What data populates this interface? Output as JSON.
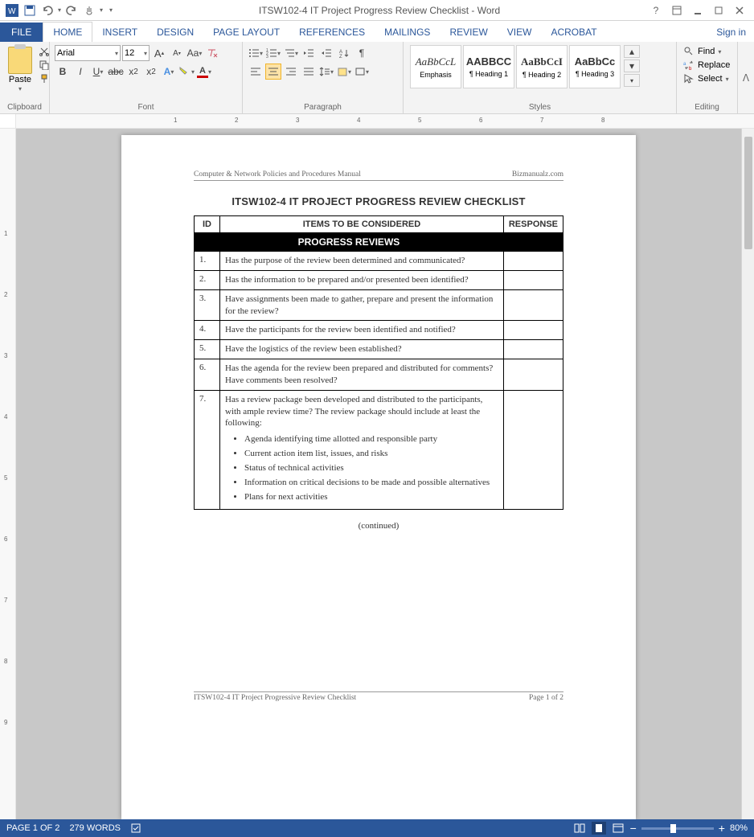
{
  "titlebar": {
    "title": "ITSW102-4 IT Project Progress Review Checklist - Word"
  },
  "tabs": {
    "file": "FILE",
    "items": [
      "HOME",
      "INSERT",
      "DESIGN",
      "PAGE LAYOUT",
      "REFERENCES",
      "MAILINGS",
      "REVIEW",
      "VIEW",
      "ACROBAT"
    ],
    "active": 0,
    "signin": "Sign in"
  },
  "ribbon": {
    "clipboard": {
      "label": "Clipboard",
      "paste": "Paste"
    },
    "font": {
      "label": "Font",
      "name": "Arial",
      "size": "12"
    },
    "paragraph": {
      "label": "Paragraph"
    },
    "styles": {
      "label": "Styles",
      "items": [
        {
          "preview": "AaBbCcL",
          "name": "Emphasis",
          "style": "italic",
          "font": "serif"
        },
        {
          "preview": "AABBCC",
          "name": "¶ Heading 1",
          "style": "bold",
          "font": "sans"
        },
        {
          "preview": "AaBbCcI",
          "name": "¶ Heading 2",
          "style": "bold",
          "font": "serif"
        },
        {
          "preview": "AaBbCc",
          "name": "¶ Heading 3",
          "style": "bold",
          "font": "sans"
        }
      ]
    },
    "editing": {
      "label": "Editing",
      "find": "Find",
      "replace": "Replace",
      "select": "Select"
    }
  },
  "document": {
    "header_left": "Computer & Network Policies and Procedures Manual",
    "header_right": "Bizmanualz.com",
    "title": "ITSW102-4   IT PROJECT PROGRESS REVIEW CHECKLIST",
    "columns": {
      "id": "ID",
      "items": "ITEMS TO BE CONSIDERED",
      "response": "RESPONSE"
    },
    "section": "PROGRESS REVIEWS",
    "rows": [
      {
        "id": "1.",
        "text": "Has the purpose of the review been determined and communicated?"
      },
      {
        "id": "2.",
        "text": "Has the information to be prepared and/or presented been identified?"
      },
      {
        "id": "3.",
        "text": "Have assignments been made to gather, prepare and present the information for the review?"
      },
      {
        "id": "4.",
        "text": "Have the participants for the review been identified and notified?"
      },
      {
        "id": "5.",
        "text": "Have the logistics of the review been established?"
      },
      {
        "id": "6.",
        "text": "Has the agenda for the review been prepared and distributed for comments? Have comments been resolved?"
      },
      {
        "id": "7.",
        "text": "Has a review package been developed and distributed to the participants, with ample review time? The review package should include at least the following:",
        "bullets": [
          "Agenda identifying time allotted and responsible party",
          "Current action item list, issues, and risks",
          "Status of technical activities",
          "Information on critical decisions to be made and possible alternatives",
          "Plans for next activities"
        ]
      }
    ],
    "continued": "(continued)",
    "footer_left": "ITSW102-4 IT Project Progressive Review Checklist",
    "footer_right": "Page 1 of 2"
  },
  "statusbar": {
    "page": "PAGE 1 OF 2",
    "words": "279 WORDS",
    "zoom": "80%"
  }
}
